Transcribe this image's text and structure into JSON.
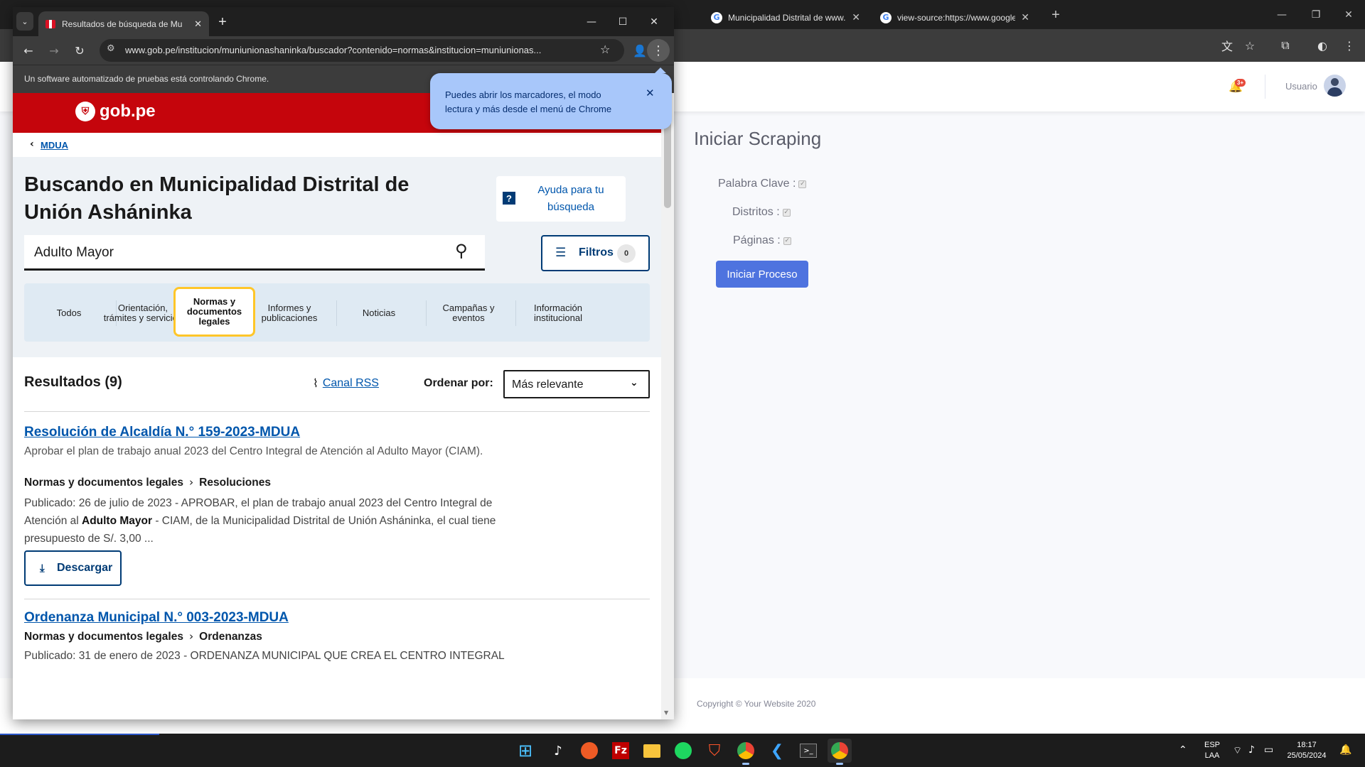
{
  "back_browser": {
    "tabs": [
      {
        "title": "Municipalidad Distrital de www.",
        "icon": "google-icon"
      },
      {
        "title": "view-source:https://www.google",
        "icon": "google-icon"
      }
    ],
    "page": {
      "user_label": "Usuario",
      "notification_badge": "3+",
      "title": "Iniciar Scraping",
      "fields": [
        {
          "label": "Palabra Clave :"
        },
        {
          "label": "Distritos :"
        },
        {
          "label": "Páginas :"
        }
      ],
      "start_button": "Iniciar Proceso",
      "copyright": "Copyright © Your Website 2020",
      "accent_color": "#4e73df"
    }
  },
  "front_browser": {
    "tab_title": "Resultados de búsqueda de Mu",
    "url": "www.gob.pe/institucion/muniunionashaninka/buscador?contenido=normas&institucion=muniunionas...",
    "automation_notice": "Un software automatizado de pruebas está controlando Chrome.",
    "bubble_text": "Puedes abrir los marcadores, el modo lectura y más desde el menú de Chrome"
  },
  "gob": {
    "logo_text": "gob.pe",
    "breadcrumb": "MDUA",
    "search_title": "Buscando en Municipalidad Distrital de Unión Asháninka",
    "help_label": "Ayuda para tu búsqueda",
    "search_value": "Adulto Mayor",
    "filters_label": "Filtros",
    "filters_count": "0",
    "categories": [
      "Todos",
      "Orientación, trámites y servicios",
      "Normas y documentos legales",
      "Informes y publicaciones",
      "Noticias",
      "Campañas y eventos",
      "Información institucional"
    ],
    "active_category": "Normas y documentos legales",
    "results_count": "Resultados (9)",
    "rss_label": "Canal RSS",
    "sort_label": "Ordenar por:",
    "sort_value": "Más relevante",
    "results": [
      {
        "title": "Resolución de Alcaldía N.° 159-2023-MDUA",
        "description": "Aprobar el plan de trabajo anual 2023 del Centro Integral de Atención al Adulto Mayor (CIAM).",
        "category": "Normas y documentos legales",
        "subcategory": "Resoluciones",
        "snippet_pre": "Publicado: 26 de julio de 2023 - ",
        "snippet_main": "APROBAR, el plan de trabajo anual 2023 del Centro Integral de Atención al ",
        "snippet_bold": "Adulto Mayor",
        "snippet_post": " - CIAM, de la Municipalidad Distrital de Unión Asháninka, el cual tiene presupuesto de S/. 3,00 ...",
        "download_label": "Descargar"
      },
      {
        "title": "Ordenanza Municipal N.° 003-2023-MDUA",
        "category": "Normas y documentos legales",
        "subcategory": "Ordenanzas",
        "snippet": "Publicado: 31 de enero de 2023 - ORDENANZA MUNICIPAL QUE CREA EL CENTRO INTEGRAL"
      }
    ]
  },
  "taskbar": {
    "language_top": "ESP",
    "language_bottom": "LAA",
    "time": "18:17",
    "date": "25/05/2024"
  }
}
